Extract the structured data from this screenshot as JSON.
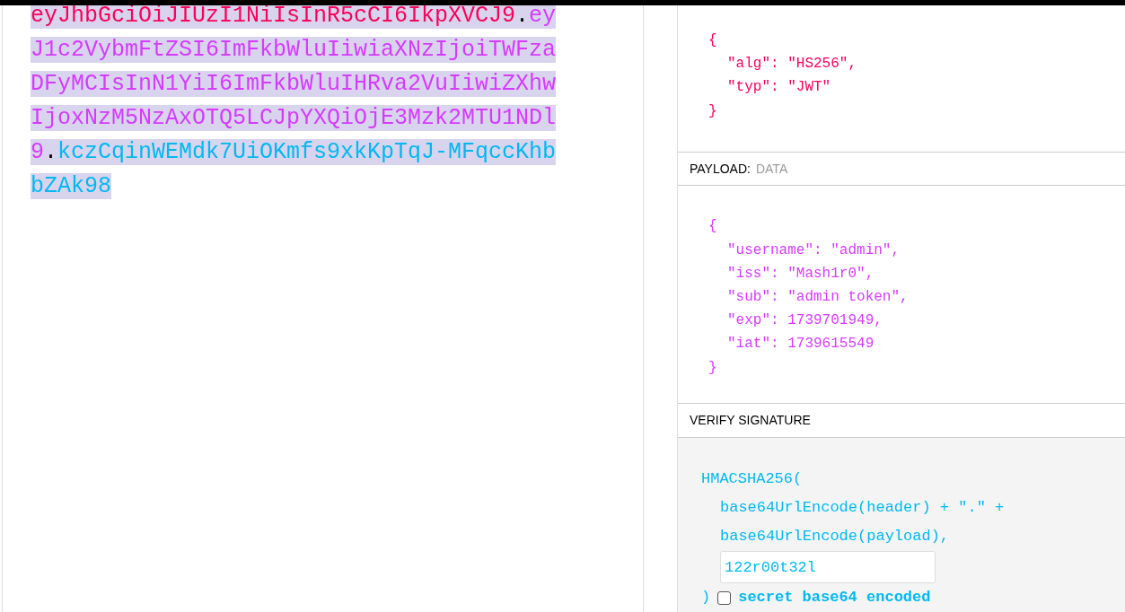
{
  "encoded_token": {
    "header": "eyJhbGciOiJIUzI1NiIsInR5cCI6IkpXVCJ9",
    "separator_1": ".",
    "payload": "eyJ1c2VybmFtZSI6ImFkbWluIiwiaXNzIjoiTWFzaDFyMCIsInN1YiI6ImFkbWluIHRva2VuIiwiZXhwIjoxNzM5NzAxOTQ5LCJpYXQiOjE3Mzk2MTU1NDl9",
    "separator_2": ".",
    "signature": "kczCqinWEMdk7UiOKmfs9xkKpTqJ-MFqccKhbbZAk98",
    "selected": true
  },
  "header_json": [
    {
      "kind": "brace",
      "text": "{"
    },
    {
      "kind": "member",
      "text": "\"alg\": \"HS256\","
    },
    {
      "kind": "member",
      "text": "\"typ\": \"JWT\""
    },
    {
      "kind": "brace",
      "text": "}"
    }
  ],
  "payload_section": {
    "label": "PAYLOAD:",
    "sublabel": "DATA"
  },
  "payload_json": [
    {
      "kind": "brace",
      "text": "{"
    },
    {
      "kind": "member",
      "text": "\"username\": \"admin\","
    },
    {
      "kind": "member",
      "text": "\"iss\": \"Mash1r0\","
    },
    {
      "kind": "member",
      "text": "\"sub\": \"admin token\","
    },
    {
      "kind": "member",
      "text": "\"exp\": 1739701949,"
    },
    {
      "kind": "member",
      "text": "\"iat\": 1739615549"
    },
    {
      "kind": "brace",
      "text": "}"
    }
  ],
  "verify_section": {
    "label": "VERIFY SIGNATURE",
    "function": "HMACSHA256(",
    "args": [
      "base64UrlEncode(header) + \".\" +",
      "base64UrlEncode(payload),"
    ],
    "secret": "122r00t32l",
    "close": ")",
    "base64_checkbox": {
      "label": "secret base64 encoded",
      "checked": false
    }
  }
}
